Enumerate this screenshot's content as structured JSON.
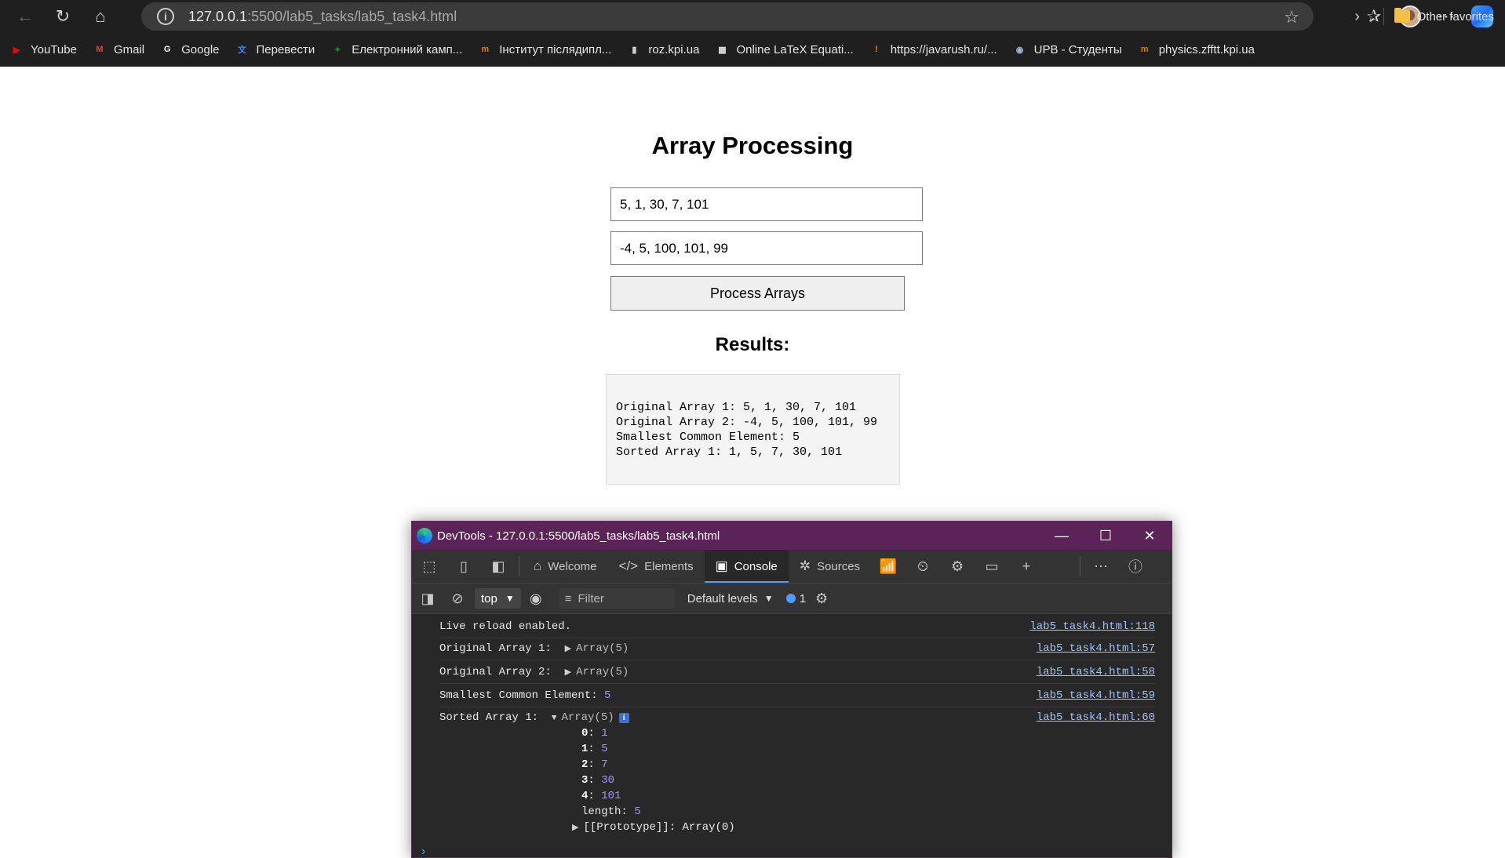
{
  "browser": {
    "url_host": "127.0.0.1",
    "url_rest": ":5500/lab5_tasks/lab5_task4.html",
    "bookmarks": [
      {
        "label": "YouTube",
        "color": "#ff0000",
        "glyph": "▶"
      },
      {
        "label": "Gmail",
        "color": "#ea4335",
        "glyph": "M"
      },
      {
        "label": "Google",
        "color": "#ffffff",
        "glyph": "G"
      },
      {
        "label": "Перевести",
        "color": "#4285f4",
        "glyph": "文"
      },
      {
        "label": "Електронний камп...",
        "color": "#2e7d32",
        "glyph": "✦"
      },
      {
        "label": "Інститут післядипл...",
        "color": "#e07b00",
        "glyph": "m"
      },
      {
        "label": "roz.kpi.ua",
        "color": "#cfcfcf",
        "glyph": "▮"
      },
      {
        "label": "Online LaTeX Equati...",
        "color": "#e0e0e0",
        "glyph": "▦"
      },
      {
        "label": "https://javarush.ru/...",
        "color": "#f5821f",
        "glyph": "!"
      },
      {
        "label": "UPB - Студенты",
        "color": "#9bb7d4",
        "glyph": "◉"
      },
      {
        "label": "physics.zfftt.kpi.ua",
        "color": "#e07b00",
        "glyph": "m"
      }
    ],
    "other_favorites": "Other favorites"
  },
  "page": {
    "title": "Array Processing",
    "input1_value": "5, 1, 30, 7, 101",
    "input2_value": "-4, 5, 100, 101, 99",
    "button_label": "Process Arrays",
    "results_heading": "Results:",
    "results_lines": [
      "Original Array 1: 5, 1, 30, 7, 101",
      "Original Array 2: -4, 5, 100, 101, 99",
      "Smallest Common Element: 5",
      "Sorted Array 1: 1, 5, 7, 30, 101"
    ]
  },
  "devtools": {
    "window_title": "DevTools - 127.0.0.1:5500/lab5_tasks/lab5_task4.html",
    "tabs": [
      {
        "label": "Welcome",
        "icon": "⌂"
      },
      {
        "label": "Elements",
        "icon": "</>"
      },
      {
        "label": "Console",
        "icon": "▣"
      },
      {
        "label": "Sources",
        "icon": "✲"
      }
    ],
    "context": "top",
    "filter_placeholder": "Filter",
    "levels": "Default levels",
    "issues_count": "1",
    "messages": {
      "m0_text": "Live reload enabled.",
      "m0_src": "lab5_task4.html:118",
      "m1_label": "Original Array 1: ",
      "m1_obj": "Array(5)",
      "m1_src": "lab5_task4.html:57",
      "m2_label": "Original Array 2: ",
      "m2_obj": "Array(5)",
      "m2_src": "lab5_task4.html:58",
      "m3_label": "Smallest Common Element: ",
      "m3_value": "5",
      "m3_src": "lab5_task4.html:59",
      "m4_label": "Sorted Array 1: ",
      "m4_obj": "Array(5)",
      "m4_src": "lab5_task4.html:60"
    },
    "tree": [
      {
        "k": "0",
        "v": "1"
      },
      {
        "k": "1",
        "v": "5"
      },
      {
        "k": "2",
        "v": "7"
      },
      {
        "k": "3",
        "v": "30"
      },
      {
        "k": "4",
        "v": "101"
      }
    ],
    "length_label": "length",
    "length_value": "5",
    "prototype_label": "[[Prototype]]",
    "prototype_value": "Array(0)"
  }
}
